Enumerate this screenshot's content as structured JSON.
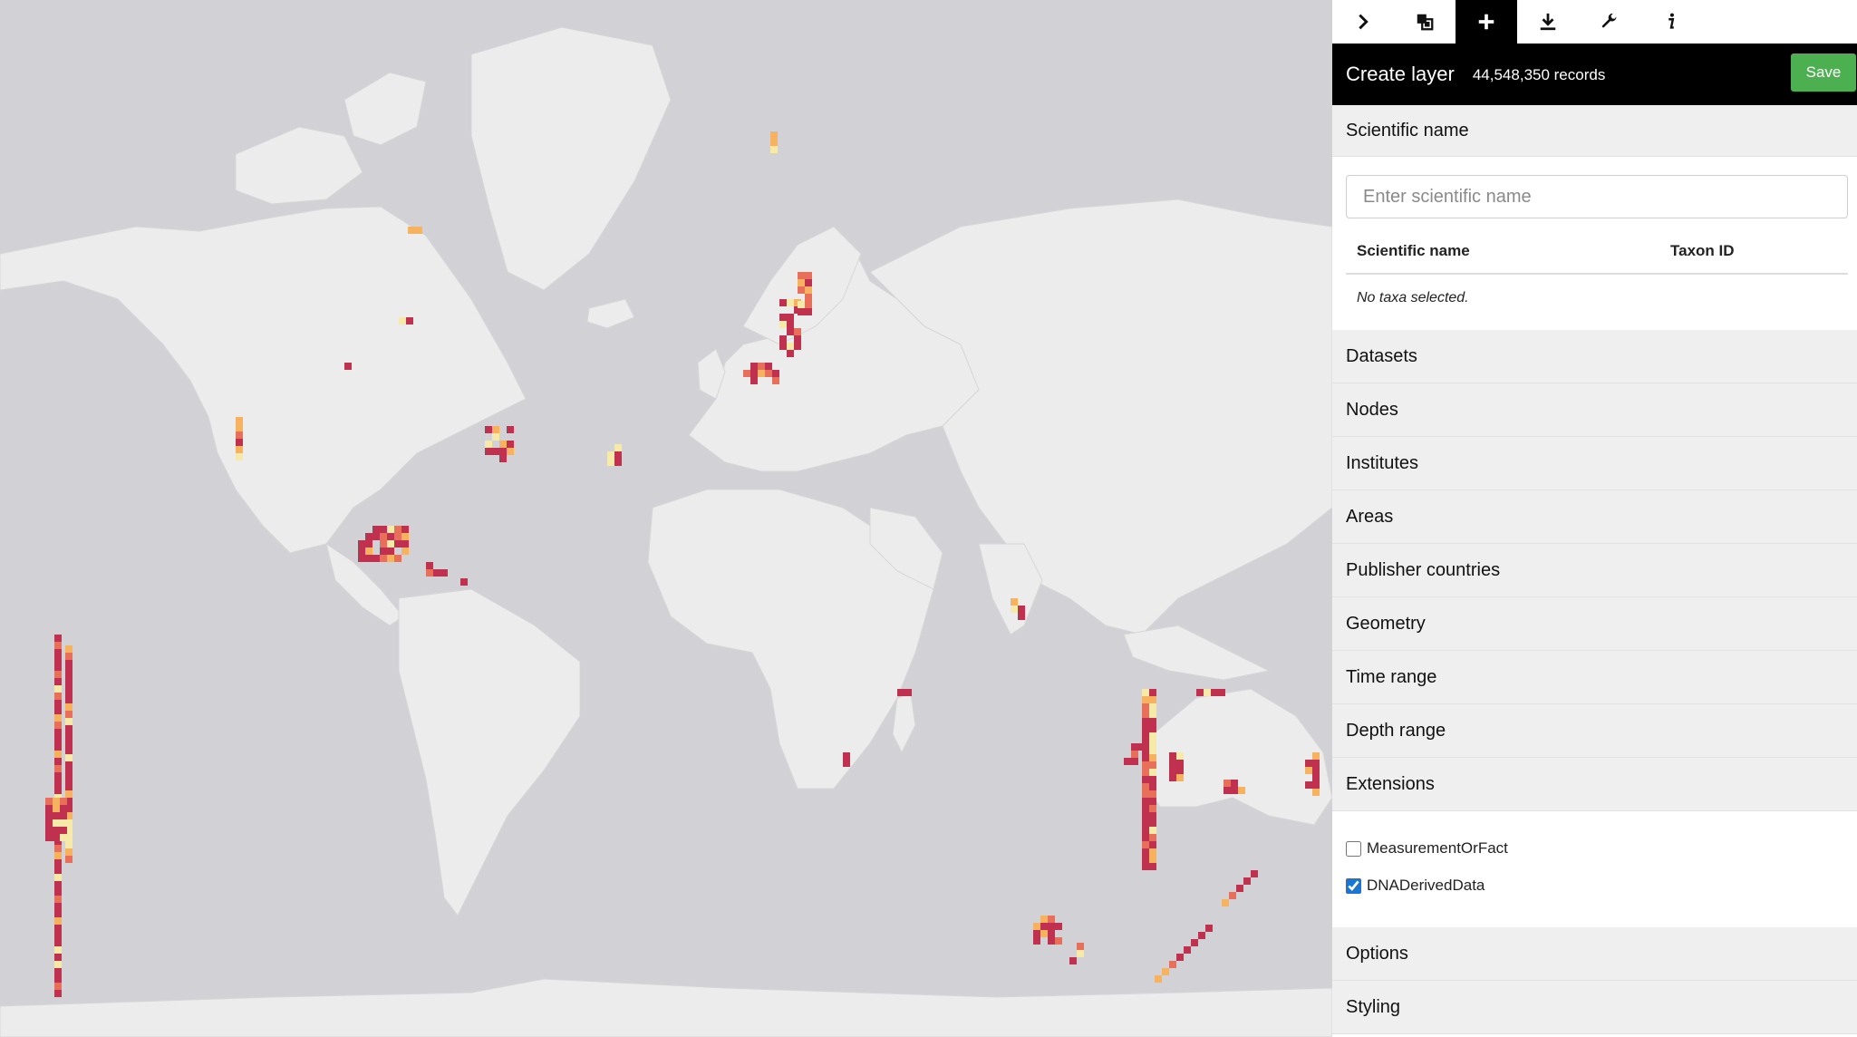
{
  "toolbar": {
    "items": [
      {
        "icon": "chevron-right-icon"
      },
      {
        "icon": "layers-icon"
      },
      {
        "icon": "plus-icon",
        "active": true
      },
      {
        "icon": "download-icon"
      },
      {
        "icon": "wrench-icon"
      },
      {
        "icon": "info-icon"
      }
    ]
  },
  "panel": {
    "title": "Create layer",
    "records": "44,548,350 records",
    "save_label": "Save"
  },
  "scientific_name": {
    "heading": "Scientific name",
    "placeholder": "Enter scientific name",
    "columns": [
      "Scientific name",
      "Taxon ID"
    ],
    "empty_text": "No taxa selected."
  },
  "filters": [
    "Datasets",
    "Nodes",
    "Institutes",
    "Areas",
    "Publisher countries",
    "Geometry",
    "Time range",
    "Depth range",
    "Extensions"
  ],
  "extensions": [
    {
      "label": "MeasurementOrFact",
      "checked": false
    },
    {
      "label": "DNADerivedData",
      "checked": true
    }
  ],
  "more_sections": [
    "Options",
    "Styling"
  ],
  "colors": {
    "heat_high": "#c0304f",
    "heat_mid": "#e8705a",
    "heat_low": "#f6b25e",
    "heat_min": "#f7e9a8",
    "land": "#ececec",
    "ocean": "#d2d2d6",
    "save": "#4caf50"
  }
}
